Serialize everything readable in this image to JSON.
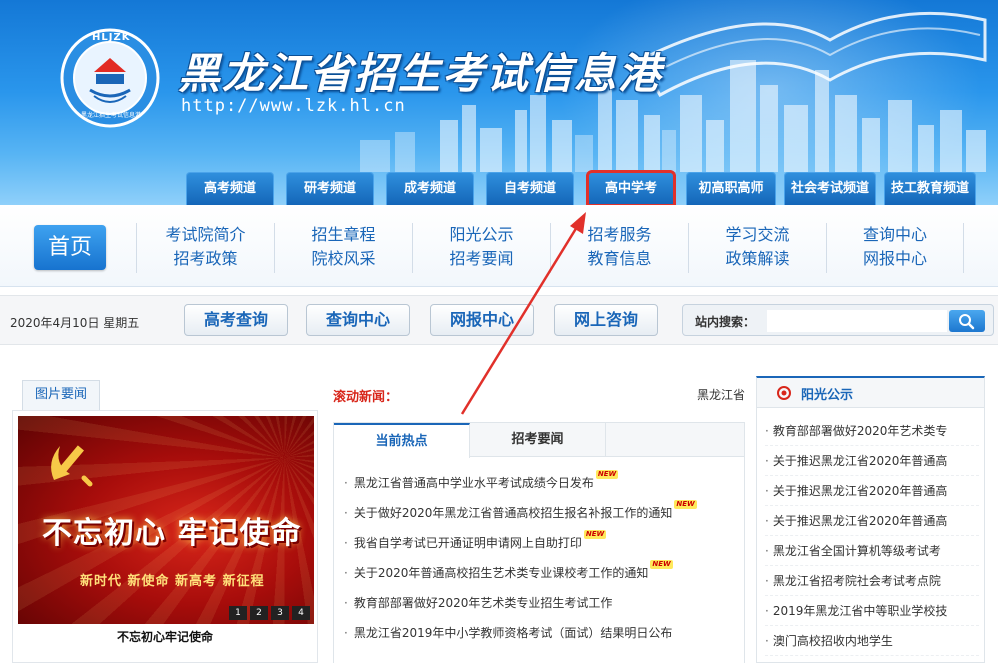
{
  "header": {
    "site_title": "黑龙江省招生考试信息港",
    "site_url": "http://www.lzk.hl.cn",
    "logo_text": "HLJZK",
    "logo_caption": "黑龙江招生考试信息港"
  },
  "channels": [
    {
      "label": "高考频道"
    },
    {
      "label": "研考频道"
    },
    {
      "label": "成考频道"
    },
    {
      "label": "自考频道"
    },
    {
      "label": "高中学考",
      "active": true
    },
    {
      "label": "初高职高师"
    },
    {
      "label": "社会考试频道"
    },
    {
      "label": "技工教育频道"
    }
  ],
  "main_nav": {
    "home_label": "首页",
    "columns": [
      {
        "top": "考试院简介",
        "bottom": "招考政策"
      },
      {
        "top": "招生章程",
        "bottom": "院校风采"
      },
      {
        "top": "阳光公示",
        "bottom": "招考要闻"
      },
      {
        "top": "招考服务",
        "bottom": "教育信息"
      },
      {
        "top": "学习交流",
        "bottom": "政策解读"
      },
      {
        "top": "查询中心",
        "bottom": "网报中心"
      }
    ]
  },
  "toolbar": {
    "date": "2020年4月10日 星期五",
    "buttons": [
      "高考查询",
      "查询中心",
      "网报中心",
      "网上咨询"
    ],
    "search_label": "站内搜索：",
    "search_placeholder": ""
  },
  "picture_news": {
    "header": "图片要闻",
    "headline": "不忘初心 牢记使命",
    "subline": "新时代  新使命  新高考  新征程",
    "caption": "不忘初心牢记使命",
    "pages": [
      "1",
      "2",
      "3",
      "4"
    ]
  },
  "ticker": {
    "label": "滚动新闻：",
    "text": "黑龙江省"
  },
  "news": {
    "tabs": [
      "当前热点",
      "招考要闻"
    ],
    "active_tab": 0,
    "new_badge": "NEW",
    "items": [
      {
        "title": "黑龙江省普通高中学业水平考试成绩今日发布",
        "new": true
      },
      {
        "title": "关于做好2020年黑龙江省普通高校招生报名补报工作的通知",
        "new": true
      },
      {
        "title": "我省自学考试已开通证明申请网上自助打印",
        "new": true
      },
      {
        "title": "关于2020年普通高校招生艺术类专业课校考工作的通知",
        "new": true
      },
      {
        "title": "教育部部署做好2020年艺术类专业招生考试工作",
        "new": false
      },
      {
        "title": "黑龙江省2019年中小学教师资格考试（面试）结果明日公布",
        "new": false
      }
    ]
  },
  "sunshine": {
    "title": "阳光公示",
    "items": [
      "教育部部署做好2020年艺术类专",
      "关于推迟黑龙江省2020年普通高",
      "关于推迟黑龙江省2020年普通高",
      "关于推迟黑龙江省2020年普通高",
      "黑龙江省全国计算机等级考试考",
      "黑龙江省招考院社会考试考点院",
      "2019年黑龙江省中等职业学校技",
      "澳门高校招收内地学生"
    ]
  },
  "colors": {
    "brand_blue": "#1a66b8",
    "banner_blue": "#1478d6",
    "alert_red": "#d8261a",
    "highlight_outline": "#e1302a"
  }
}
